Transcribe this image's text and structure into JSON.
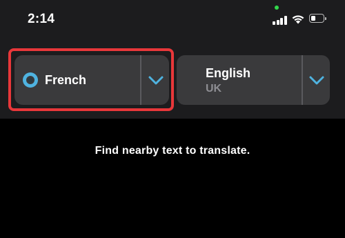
{
  "status_bar": {
    "time": "2:14",
    "icons": [
      "camera-in-use-indicator",
      "cellular-signal-icon",
      "wifi-icon",
      "battery-icon"
    ],
    "battery_level": 0.35,
    "indicator_color": "#32d74b"
  },
  "language_selector": {
    "source": {
      "name": "French",
      "icon": "radio-dot-icon",
      "expand_icon": "chevron-down-icon",
      "highlighted": true
    },
    "target": {
      "name": "English",
      "region": "UK",
      "expand_icon": "chevron-down-icon"
    }
  },
  "main": {
    "prompt": "Find nearby text to translate."
  },
  "colors": {
    "accent": "#4fb3e0",
    "highlight": "#e8373a",
    "panel": "#3a3a3c",
    "background": "#000000",
    "header": "#1c1c1e",
    "secondary_text": "#8e8e93"
  }
}
